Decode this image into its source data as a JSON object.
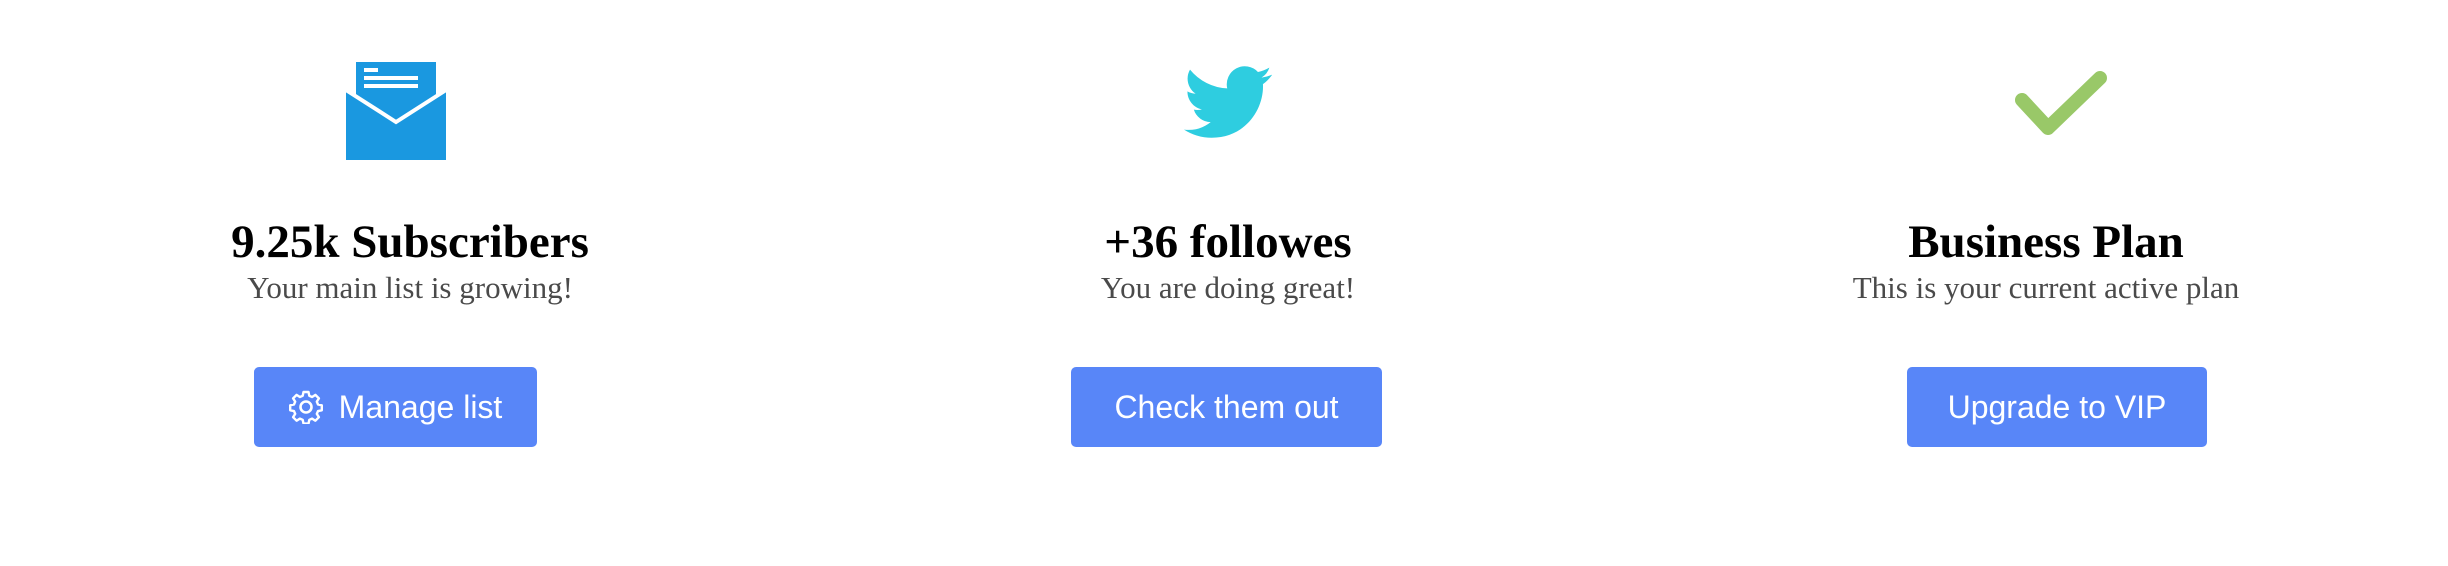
{
  "cards": [
    {
      "icon": "mail-open-icon",
      "icon_color": "#1a98e0",
      "title": "9.25k Subscribers",
      "subtitle": "Your main list is growing!",
      "button": {
        "label": "Manage list",
        "icon": "gear-icon"
      }
    },
    {
      "icon": "twitter-bird-icon",
      "icon_color": "#2ecde0",
      "title": "+36 followes",
      "subtitle": "You are doing great!",
      "button": {
        "label": "Check them out"
      }
    },
    {
      "icon": "checkmark-icon",
      "icon_color": "#99c868",
      "title": "Business Plan",
      "subtitle": "This is your current active plan",
      "button": {
        "label": "Upgrade to VIP"
      }
    }
  ],
  "colors": {
    "button_bg": "#5886f8",
    "button_text": "#ffffff",
    "title": "#000000",
    "subtitle": "#4a4a4a"
  }
}
